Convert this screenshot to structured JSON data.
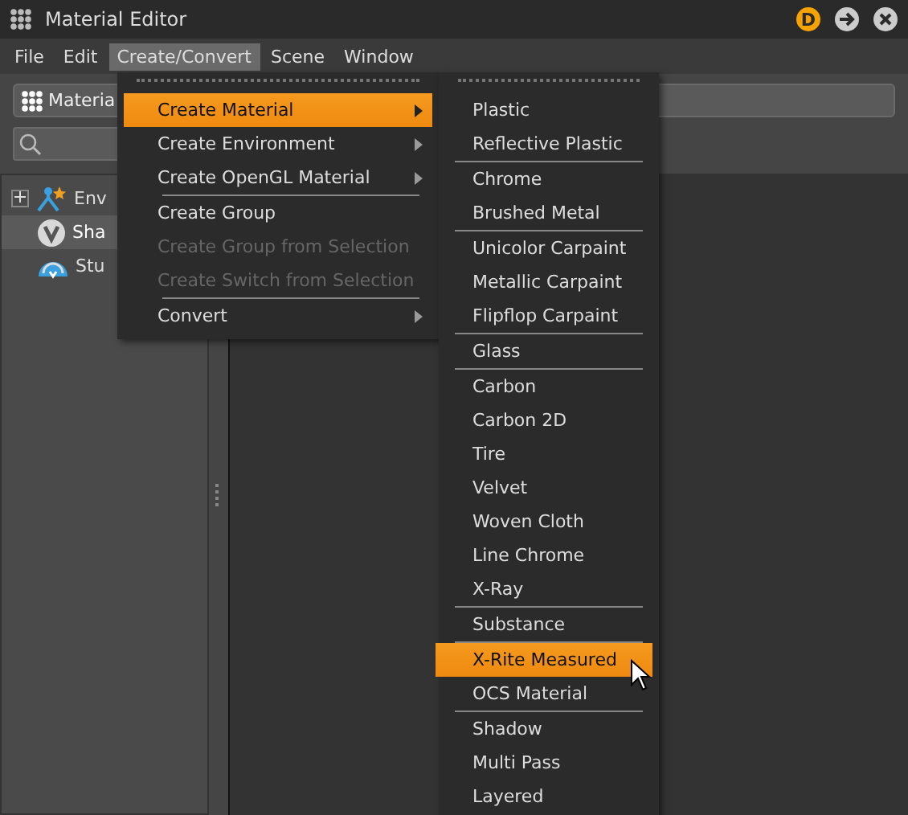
{
  "window": {
    "title": "Material Editor",
    "badge": "D"
  },
  "menubar": [
    {
      "label": "File",
      "selected": false
    },
    {
      "label": "Edit",
      "selected": false
    },
    {
      "label": "Create/Convert",
      "selected": true
    },
    {
      "label": "Scene",
      "selected": false
    },
    {
      "label": "Window",
      "selected": false
    }
  ],
  "toolbar": {
    "button": "Materia"
  },
  "tree": [
    {
      "label": "Env",
      "kind": "environment",
      "expandable": true,
      "selected": false
    },
    {
      "label": "Sha",
      "kind": "shader",
      "expandable": false,
      "selected": true
    },
    {
      "label": "Stu",
      "kind": "studio",
      "expandable": false,
      "selected": false
    }
  ],
  "menu": {
    "groups": [
      [
        {
          "label": "Create Material",
          "submenu": true,
          "selected": true,
          "disabled": false
        },
        {
          "label": "Create Environment",
          "submenu": true,
          "selected": false,
          "disabled": false
        },
        {
          "label": "Create OpenGL Material",
          "submenu": true,
          "selected": false,
          "disabled": false
        }
      ],
      [
        {
          "label": "Create Group",
          "submenu": false,
          "selected": false,
          "disabled": false
        },
        {
          "label": "Create Group from Selection",
          "submenu": false,
          "selected": false,
          "disabled": true
        },
        {
          "label": "Create Switch from Selection",
          "submenu": false,
          "selected": false,
          "disabled": true
        }
      ],
      [
        {
          "label": "Convert",
          "submenu": true,
          "selected": false,
          "disabled": false
        }
      ]
    ]
  },
  "submenu": {
    "groups": [
      [
        {
          "label": "Plastic",
          "selected": false
        },
        {
          "label": "Reflective Plastic",
          "selected": false
        }
      ],
      [
        {
          "label": "Chrome",
          "selected": false
        },
        {
          "label": "Brushed Metal",
          "selected": false
        }
      ],
      [
        {
          "label": "Unicolor Carpaint",
          "selected": false
        },
        {
          "label": "Metallic Carpaint",
          "selected": false
        },
        {
          "label": "Flipflop Carpaint",
          "selected": false
        }
      ],
      [
        {
          "label": "Glass",
          "selected": false
        }
      ],
      [
        {
          "label": "Carbon",
          "selected": false
        },
        {
          "label": "Carbon 2D",
          "selected": false
        },
        {
          "label": "Tire",
          "selected": false
        },
        {
          "label": "Velvet",
          "selected": false
        },
        {
          "label": "Woven Cloth",
          "selected": false
        },
        {
          "label": "Line Chrome",
          "selected": false
        },
        {
          "label": "X-Ray",
          "selected": false
        }
      ],
      [
        {
          "label": "Substance",
          "selected": false
        }
      ],
      [
        {
          "label": "X-Rite Measured",
          "selected": true
        },
        {
          "label": "OCS Material",
          "selected": false
        }
      ],
      [
        {
          "label": "Shadow",
          "selected": false
        },
        {
          "label": "Multi Pass",
          "selected": false
        },
        {
          "label": "Layered",
          "selected": false
        }
      ]
    ]
  }
}
